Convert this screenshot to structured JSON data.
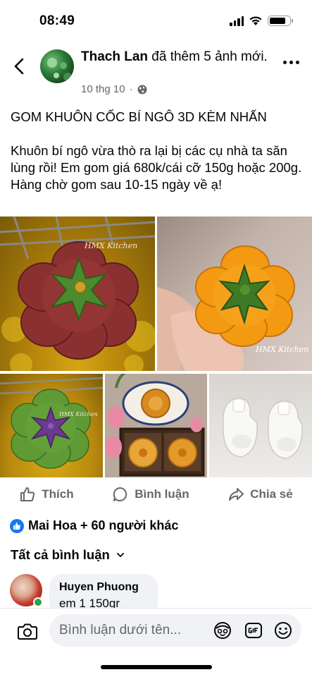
{
  "status_bar": {
    "time": "08:49",
    "icons": [
      "cellular-signal-icon",
      "wifi-icon",
      "battery-icon"
    ],
    "battery_level": 0.8
  },
  "post": {
    "author": "Thach Lan",
    "action_text": " đã thêm 5 ảnh mới.",
    "date": "10 thg 10",
    "separator": "·",
    "privacy_icon": "globe-icon",
    "text_lines": [
      "GOM KHUÔN CỐC BÍ NGÔ 3D KÈM NHẤN",
      "",
      "Khuôn bí ngô vừa thò ra lại bị các cụ nhà ta săn lùng rồi! Em gom giá 680k/cái cỡ 150g hoặc 200g.",
      "Hàng chờ gom sau 10-15 ngày về ạ!"
    ],
    "photos": [
      {
        "name": "photo-1",
        "watermark": "HMX Kitchen"
      },
      {
        "name": "photo-2",
        "watermark": "HMX Kitchen"
      },
      {
        "name": "photo-3",
        "watermark": "HMX Kitchen"
      },
      {
        "name": "photo-4"
      },
      {
        "name": "photo-5"
      }
    ]
  },
  "actions": {
    "like": "Thích",
    "comment": "Bình luận",
    "share": "Chia sẻ"
  },
  "reactions": {
    "summary": "Mai Hoa + 60 người khác",
    "icon": "like-reaction-icon"
  },
  "comments": {
    "sort_label": "Tất cả bình luận",
    "items": [
      {
        "author": "Huyen Phuong",
        "text": "em 1 150gr",
        "online": true
      }
    ]
  },
  "composer": {
    "placeholder": "Bình luận dưới tên...",
    "icons": [
      "camera-icon",
      "avatar-sticker-icon",
      "gif-icon",
      "emoji-icon"
    ]
  },
  "colors": {
    "accent": "#1877f2",
    "secondary_text": "#65676b",
    "online": "#31a24c",
    "bubble_bg": "#f0f2f5"
  }
}
